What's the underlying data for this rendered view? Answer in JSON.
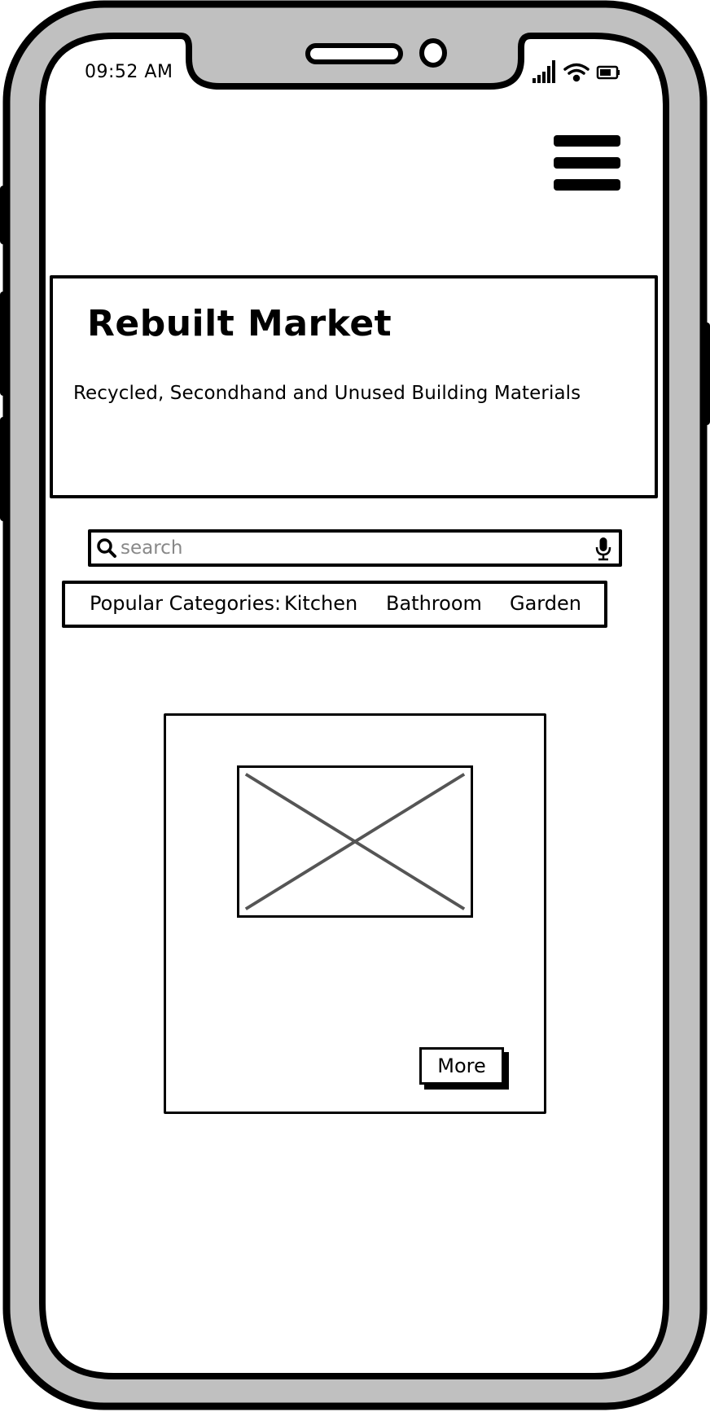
{
  "status_bar": {
    "time": "09:52 AM",
    "icons": [
      "signal-icon",
      "wifi-icon",
      "battery-icon"
    ]
  },
  "header": {
    "menu_icon": "hamburger-menu-icon"
  },
  "hero": {
    "title": "Rebuilt Market",
    "subtitle": "Recycled, Secondhand and Unused Building Materials"
  },
  "search": {
    "placeholder": "search",
    "value": "",
    "icons": [
      "search-icon",
      "microphone-icon"
    ]
  },
  "categories": {
    "label": "Popular Categories:",
    "items": [
      "Kitchen",
      "Bathroom",
      "Garden"
    ]
  },
  "product_card": {
    "image_icon": "image-placeholder-icon",
    "more_label": "More"
  },
  "colors": {
    "frame": "#c0c0c0",
    "ink": "#000000",
    "placeholder": "#888888",
    "image_cross": "#555555"
  }
}
